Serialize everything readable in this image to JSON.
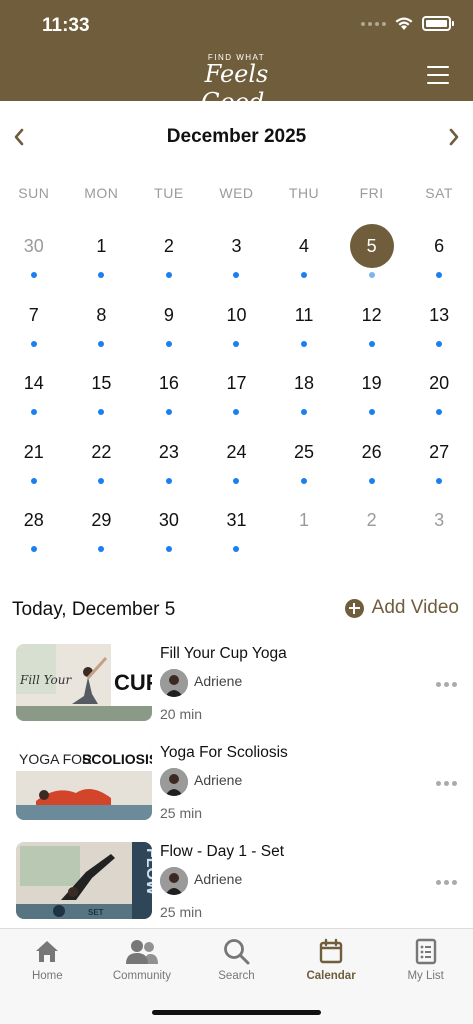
{
  "status": {
    "time": "11:33"
  },
  "header": {
    "logo_top": "FIND WHAT",
    "logo_main": "Feels Good."
  },
  "calendar": {
    "month_title": "December 2025",
    "weekdays": [
      "SUN",
      "MON",
      "TUE",
      "WED",
      "THU",
      "FRI",
      "SAT"
    ],
    "days": [
      {
        "n": "30",
        "muted": true,
        "dot": true,
        "selected": false
      },
      {
        "n": "1",
        "muted": false,
        "dot": true,
        "selected": false
      },
      {
        "n": "2",
        "muted": false,
        "dot": true,
        "selected": false
      },
      {
        "n": "3",
        "muted": false,
        "dot": true,
        "selected": false
      },
      {
        "n": "4",
        "muted": false,
        "dot": true,
        "selected": false
      },
      {
        "n": "5",
        "muted": false,
        "dot": true,
        "selected": true
      },
      {
        "n": "6",
        "muted": false,
        "dot": true,
        "selected": false
      },
      {
        "n": "7",
        "muted": false,
        "dot": true,
        "selected": false
      },
      {
        "n": "8",
        "muted": false,
        "dot": true,
        "selected": false
      },
      {
        "n": "9",
        "muted": false,
        "dot": true,
        "selected": false
      },
      {
        "n": "10",
        "muted": false,
        "dot": true,
        "selected": false
      },
      {
        "n": "11",
        "muted": false,
        "dot": true,
        "selected": false
      },
      {
        "n": "12",
        "muted": false,
        "dot": true,
        "selected": false
      },
      {
        "n": "13",
        "muted": false,
        "dot": true,
        "selected": false
      },
      {
        "n": "14",
        "muted": false,
        "dot": true,
        "selected": false
      },
      {
        "n": "15",
        "muted": false,
        "dot": true,
        "selected": false
      },
      {
        "n": "16",
        "muted": false,
        "dot": true,
        "selected": false
      },
      {
        "n": "17",
        "muted": false,
        "dot": true,
        "selected": false
      },
      {
        "n": "18",
        "muted": false,
        "dot": true,
        "selected": false
      },
      {
        "n": "19",
        "muted": false,
        "dot": true,
        "selected": false
      },
      {
        "n": "20",
        "muted": false,
        "dot": true,
        "selected": false
      },
      {
        "n": "21",
        "muted": false,
        "dot": true,
        "selected": false
      },
      {
        "n": "22",
        "muted": false,
        "dot": true,
        "selected": false
      },
      {
        "n": "23",
        "muted": false,
        "dot": true,
        "selected": false
      },
      {
        "n": "24",
        "muted": false,
        "dot": true,
        "selected": false
      },
      {
        "n": "25",
        "muted": false,
        "dot": true,
        "selected": false
      },
      {
        "n": "26",
        "muted": false,
        "dot": true,
        "selected": false
      },
      {
        "n": "27",
        "muted": false,
        "dot": true,
        "selected": false
      },
      {
        "n": "28",
        "muted": false,
        "dot": true,
        "selected": false
      },
      {
        "n": "29",
        "muted": false,
        "dot": true,
        "selected": false
      },
      {
        "n": "30",
        "muted": false,
        "dot": true,
        "selected": false
      },
      {
        "n": "31",
        "muted": false,
        "dot": true,
        "selected": false
      },
      {
        "n": "1",
        "muted": true,
        "dot": false,
        "selected": false
      },
      {
        "n": "2",
        "muted": true,
        "dot": false,
        "selected": false
      },
      {
        "n": "3",
        "muted": true,
        "dot": false,
        "selected": false
      }
    ]
  },
  "today": {
    "title": "Today, December 5",
    "add_label": "Add Video"
  },
  "videos": [
    {
      "title": "Fill Your Cup Yoga",
      "author": "Adriene",
      "duration": "20 min",
      "thumb_text": "CUP",
      "thumb_script": "Fill Your"
    },
    {
      "title": "Yoga For Scoliosis",
      "author": "Adriene",
      "duration": "25 min",
      "thumb_text": "SCOLIOSIS",
      "thumb_script": "YOGA FOR"
    },
    {
      "title": "Flow - Day 1 - Set",
      "author": "Adriene",
      "duration": "25 min",
      "thumb_text": "FLOW",
      "thumb_script": "SET"
    }
  ],
  "tabs": [
    {
      "label": "Home",
      "icon": "home-icon",
      "active": false
    },
    {
      "label": "Community",
      "icon": "community-icon",
      "active": false
    },
    {
      "label": "Search",
      "icon": "search-icon",
      "active": false
    },
    {
      "label": "Calendar",
      "icon": "calendar-icon",
      "active": true
    },
    {
      "label": "My List",
      "icon": "list-icon",
      "active": false
    }
  ],
  "colors": {
    "brand": "#6f5d3c",
    "dot": "#1a7ff0",
    "muted": "#9b9b9b"
  }
}
